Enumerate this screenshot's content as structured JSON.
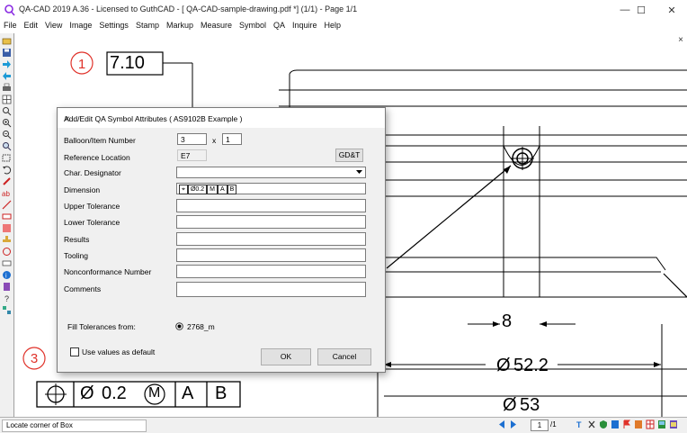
{
  "window": {
    "title": "QA-CAD 2019 A.36 - Licensed to GuthCAD  -  [ QA-CAD-sample-drawing.pdf *] (1/1)  - Page 1/1",
    "minimize": "—",
    "maximize": "☐",
    "close": "✕"
  },
  "menu": [
    "File",
    "Edit",
    "View",
    "Image",
    "Settings",
    "Stamp",
    "Markup",
    "Measure",
    "Symbol",
    "QA",
    "Inquire",
    "Help"
  ],
  "drawing": {
    "balloon1": "1",
    "balloon3": "3",
    "dim_top": "7.10",
    "dim_8": "8",
    "dim_52": "52.2",
    "dim_53": "53",
    "diameter_symbol": "Ø",
    "fcf": {
      "tolerance": "0.2",
      "modifier": "M",
      "datum_a": "A",
      "datum_b": "B"
    },
    "canvas_close": "×"
  },
  "dialog": {
    "title": "Add/Edit QA Symbol Attributes  ( AS9102B Example )",
    "close": "✕",
    "fields": {
      "balloon": {
        "label": "Balloon/Item Number",
        "value": "3",
        "times": "x",
        "count": "1"
      },
      "reference": {
        "label": "Reference Location",
        "value": "E7",
        "button": "GD&T"
      },
      "char_designator": {
        "label": "Char. Designator",
        "value": ""
      },
      "dimension": {
        "label": "Dimension",
        "fcf": {
          "tolerance": "Ø0.2",
          "modifier": "M",
          "datum_a": "A",
          "datum_b": "B"
        }
      },
      "upper_tol": {
        "label": "Upper Tolerance",
        "value": ""
      },
      "lower_tol": {
        "label": "Lower Tolerance",
        "value": ""
      },
      "results": {
        "label": "Results",
        "value": ""
      },
      "tooling": {
        "label": "Tooling",
        "value": ""
      },
      "ncr": {
        "label": "Nonconformance Number",
        "value": ""
      },
      "comments": {
        "label": "Comments",
        "value": ""
      }
    },
    "fill_from": {
      "label": "Fill Tolerances from:",
      "option": "2768_m",
      "selected": true
    },
    "use_default": {
      "label": "Use values as default",
      "checked": false
    },
    "ok": "OK",
    "cancel": "Cancel"
  },
  "status": {
    "text": "Locate corner of Box",
    "page": "1",
    "page_total": "/1"
  },
  "colors": {
    "balloon_red": "#e0322a",
    "arrow_blue": "#1c6fd1",
    "dialog_bg": "#f0f0f0"
  }
}
